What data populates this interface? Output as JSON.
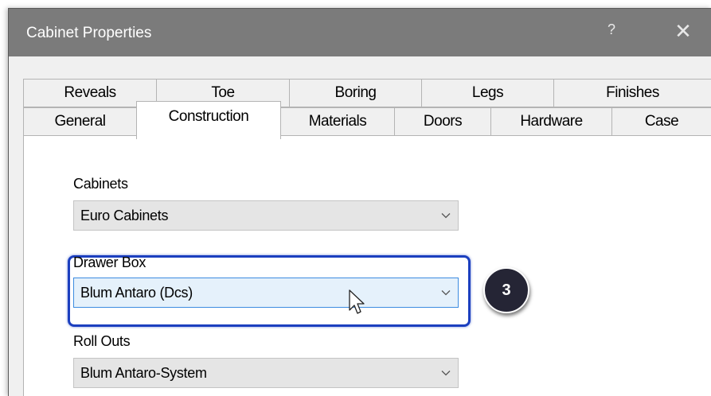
{
  "window": {
    "title": "Cabinet Properties",
    "help_label": "?",
    "close_label": "✕"
  },
  "tabs": {
    "row1": [
      "Reveals",
      "Toe",
      "Boring",
      "Legs",
      "Finishes"
    ],
    "row2": [
      "General",
      "Construction",
      "Materials",
      "Doors",
      "Hardware",
      "Case"
    ],
    "selected": "Construction"
  },
  "fields": {
    "cabinets": {
      "label": "Cabinets",
      "value": "Euro Cabinets"
    },
    "drawer_box": {
      "label": "Drawer Box",
      "value": "Blum Antaro (Dcs)"
    },
    "roll_outs": {
      "label": "Roll Outs",
      "value": "Blum Antaro-System"
    }
  },
  "annotation": {
    "step": "3"
  },
  "colors": {
    "titlebar": "#7b7b7b",
    "highlight": "#1b3fbf",
    "badge": "#252535",
    "combo_active": "#e5f1fb"
  }
}
